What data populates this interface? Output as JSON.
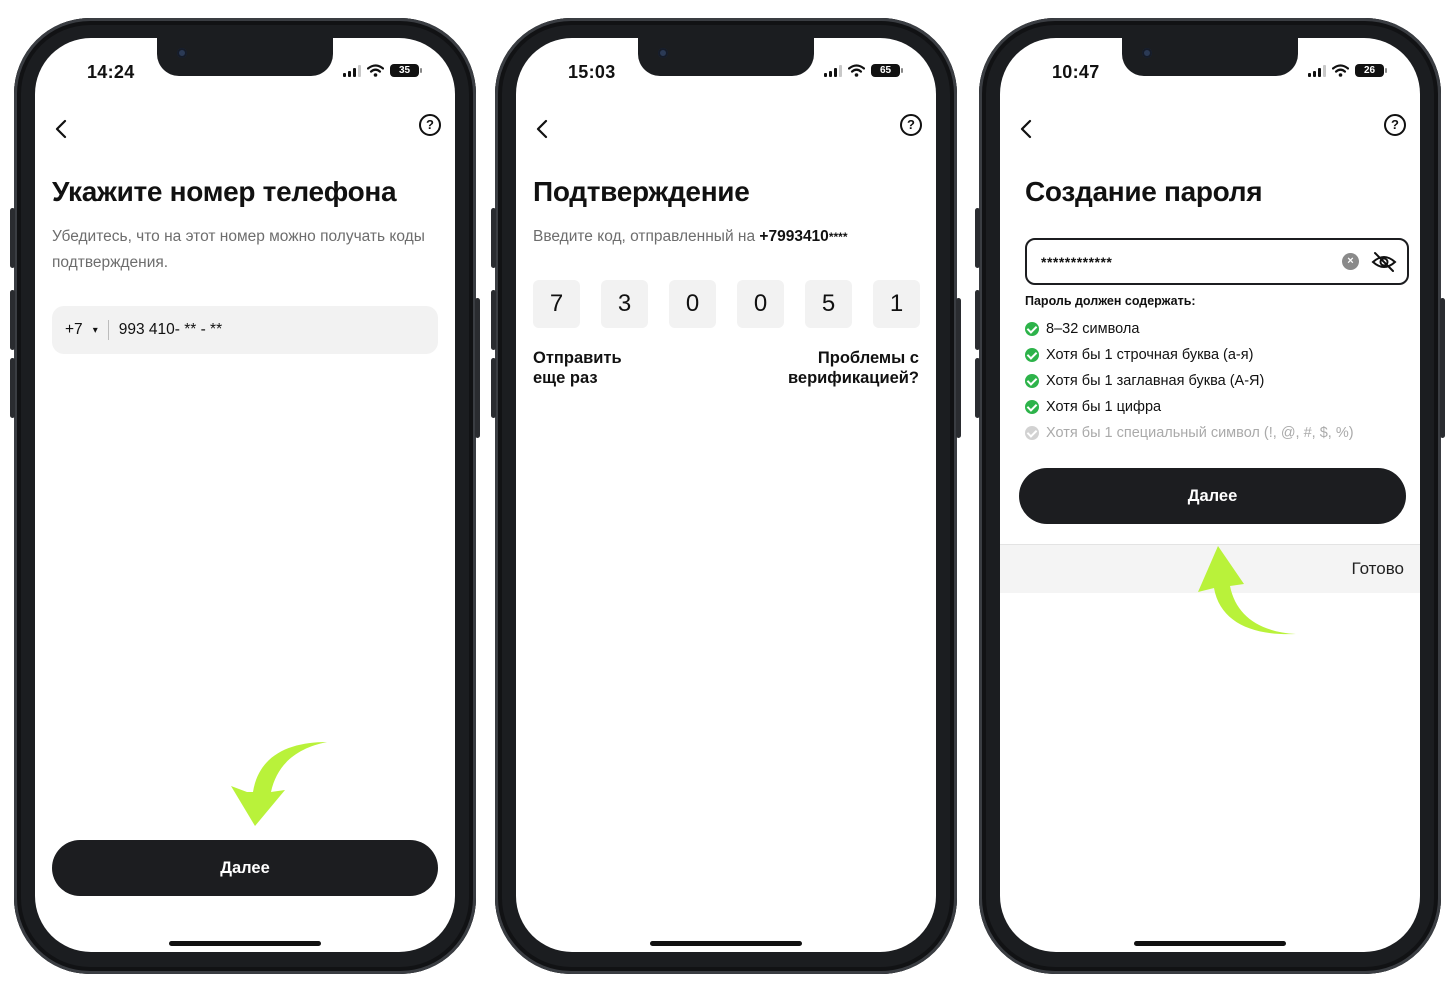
{
  "accent": {
    "arrow": "#b9f23a",
    "button": "#1c1d20",
    "check": "#2db34a"
  },
  "screens": [
    {
      "status": {
        "time": "14:24",
        "battery": "35"
      },
      "nav": {
        "back_icon": "chevron-left-icon",
        "help_icon": "question-circle-icon",
        "help_glyph": "?"
      },
      "title": "Укажите номер телефона",
      "subtitle": "Убедитесь, что на этот номер можно получать коды подтверждения.",
      "phone_field": {
        "country_code": "+7",
        "caret": "▾",
        "value": "993 410- ** - **"
      },
      "button": "Далее"
    },
    {
      "status": {
        "time": "15:03",
        "battery": "65"
      },
      "nav": {
        "back_icon": "chevron-left-icon",
        "help_icon": "question-circle-icon",
        "help_glyph": "?"
      },
      "title": "Подтверждение",
      "subtitle_prefix": "Введите код, отправленный на ",
      "subtitle_phone": "+7993410",
      "subtitle_mask": "****",
      "code": [
        "7",
        "3",
        "0",
        "0",
        "5",
        "1"
      ],
      "resend_line1": "Отправить",
      "resend_line2": "еще раз",
      "problems_line1": "Проблемы с",
      "problems_line2": "верификацией?"
    },
    {
      "status": {
        "time": "10:47",
        "battery": "26"
      },
      "nav": {
        "back_icon": "chevron-left-icon",
        "help_icon": "question-circle-icon",
        "help_glyph": "?"
      },
      "title": "Создание пароля",
      "password_value": "************",
      "clear_glyph": "×",
      "rules_title": "Пароль должен содержать:",
      "rules": [
        {
          "text": "8–32 символа",
          "met": true
        },
        {
          "text": "Хотя бы 1 строчная буква (а-я)",
          "met": true
        },
        {
          "text": "Хотя бы 1 заглавная буква (А-Я)",
          "met": true
        },
        {
          "text": "Хотя бы 1 цифра",
          "met": true
        },
        {
          "text": "Хотя бы 1 специальный символ (!, @, #, $, %)",
          "met": false
        }
      ],
      "button": "Далее",
      "keyboard_done": "Готово"
    }
  ]
}
